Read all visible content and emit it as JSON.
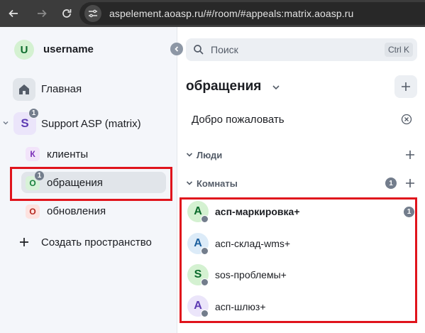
{
  "browser": {
    "url": "aspelement.aoasp.ru/#/room/#appeals:matrix.aoasp.ru"
  },
  "sidebar": {
    "user": {
      "avatar_letter": "U",
      "name": "username"
    },
    "home": {
      "label": "Главная",
      "icon": "home-icon"
    },
    "space": {
      "avatar_letter": "S",
      "name": "Support ASP (matrix)",
      "badge": "1",
      "children": [
        {
          "avatar_letter": "К",
          "label": "клиенты",
          "color": "#7b2fb8",
          "bg": "#f2e4fa"
        },
        {
          "avatar_letter": "О",
          "label": "обращения",
          "color": "#17803d",
          "bg": "#d8f2d8",
          "badge": "1",
          "selected": true
        },
        {
          "avatar_letter": "О",
          "label": "обновления",
          "color": "#b4261e",
          "bg": "#fde2df"
        }
      ]
    },
    "create_space": {
      "label": "Создать пространство"
    }
  },
  "room_list": {
    "search": {
      "placeholder": "Поиск",
      "shortcut": "Ctrl K"
    },
    "title": "обращения",
    "welcome": "Добро пожаловать",
    "sections": {
      "people": {
        "label": "Люди"
      },
      "rooms": {
        "label": "Комнаты",
        "badge": "1"
      }
    },
    "rooms": [
      {
        "avatar_letter": "А",
        "name": "асп-маркировка+",
        "color": "#0c6b2c",
        "bg": "#d4f1d1",
        "unread": "1",
        "bold": true
      },
      {
        "avatar_letter": "А",
        "name": "асп-склад-wms+",
        "color": "#1b5f9e",
        "bg": "#dcebf8"
      },
      {
        "avatar_letter": "S",
        "name": "sos-проблемы+",
        "color": "#0c6b2c",
        "bg": "#d4f1d1"
      },
      {
        "avatar_letter": "А",
        "name": "асп-шлюз+",
        "color": "#5d3bb3",
        "bg": "#ebe5fa"
      }
    ]
  },
  "colors": {
    "highlight_border": "#e0141c",
    "badge": "#737d8c",
    "sidebar_bg": "#f4f6fa"
  }
}
